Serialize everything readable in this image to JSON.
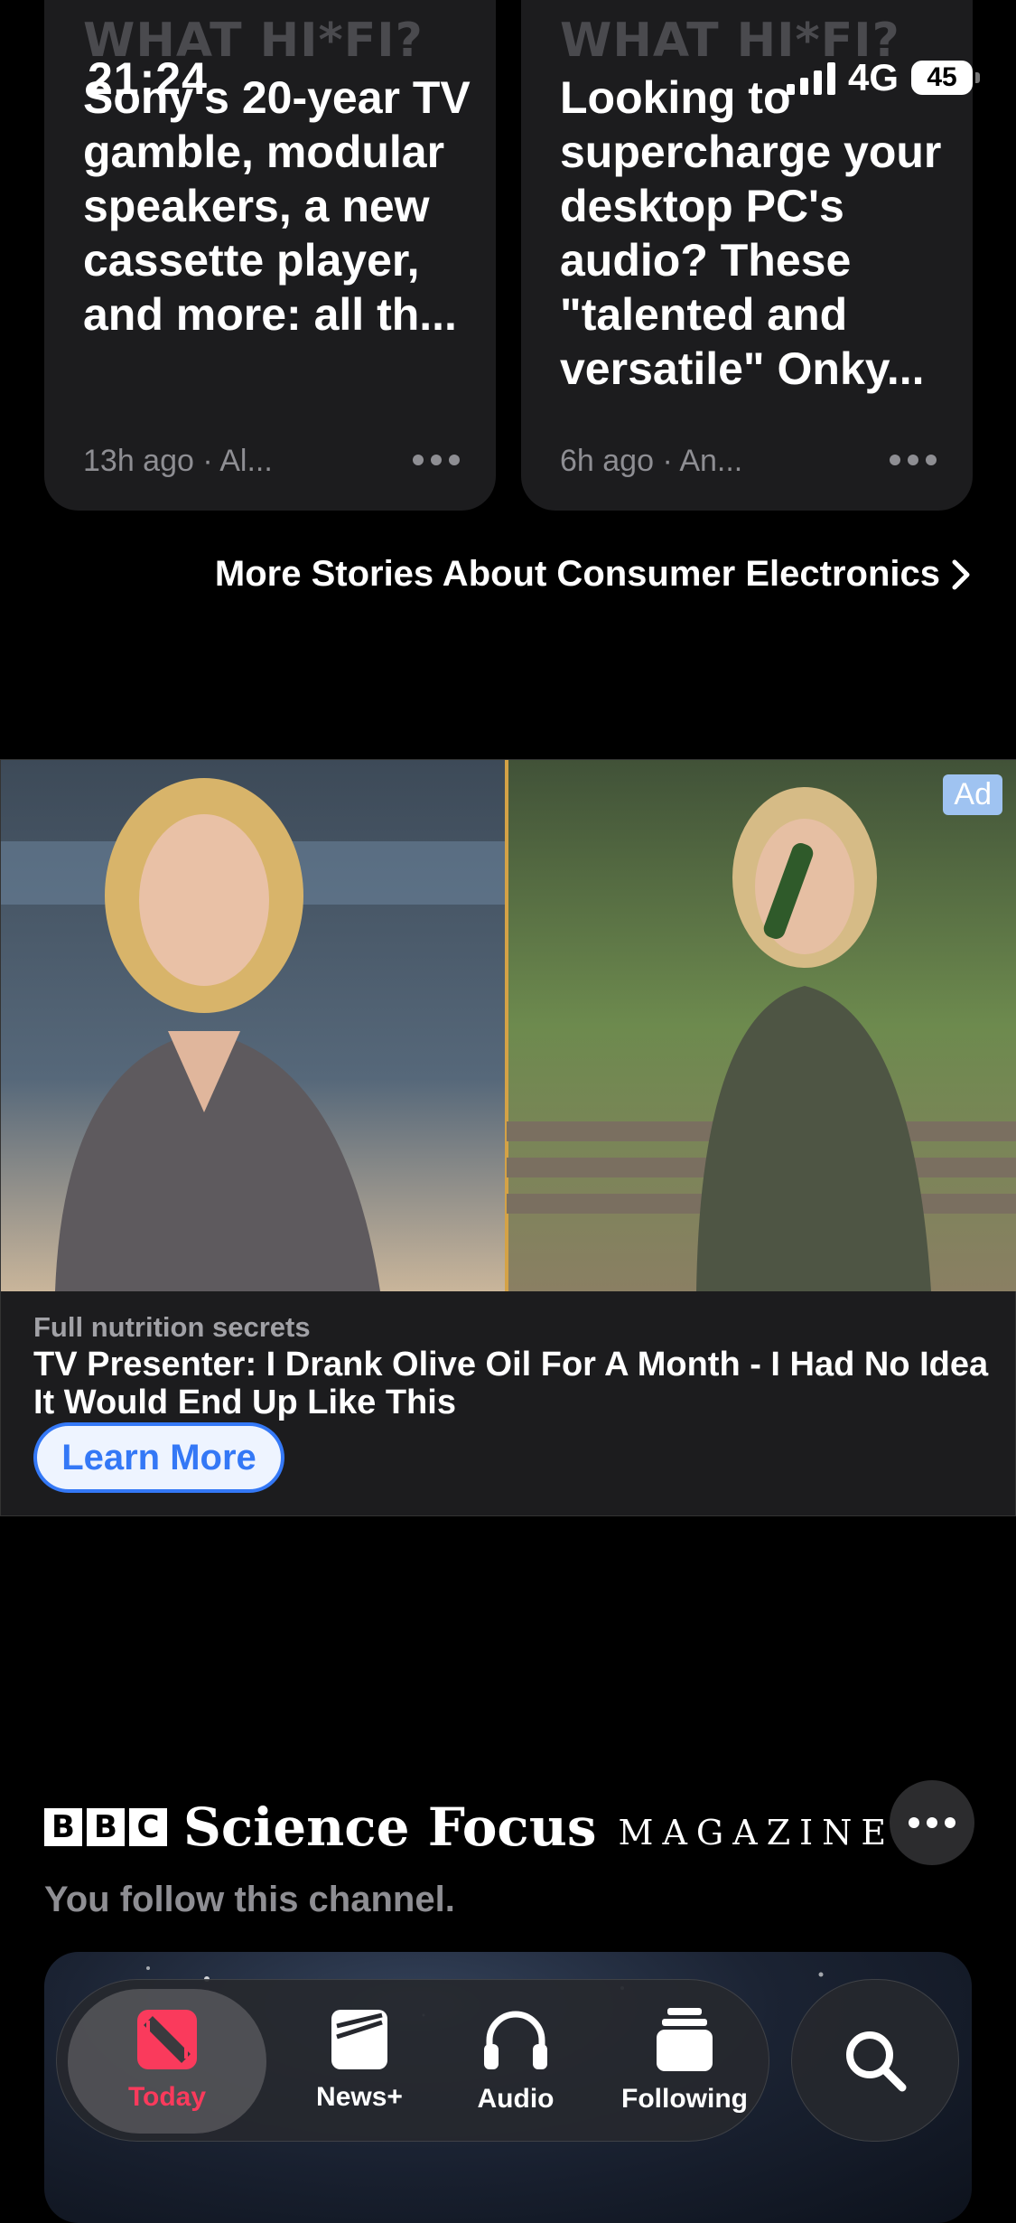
{
  "status_bar": {
    "time": "21:24",
    "network": "4G",
    "battery": "45"
  },
  "stories": [
    {
      "source": "WHAT HI*FI?",
      "title": "Sony's 20-year TV gamble, modular speakers, a new cassette player, and more: all th...",
      "meta": "13h ago · Al..."
    },
    {
      "source": "WHAT HI*FI?",
      "title": "Looking to supercharge your desktop PC's audio? These \"talented and versatile\" Onky...",
      "meta": "6h ago · An..."
    }
  ],
  "more_stories": "More Stories About Consumer Electronics",
  "ad": {
    "badge": "Ad",
    "sponsor": "Full nutrition secrets",
    "title": "TV Presenter: I Drank Olive Oil For A Month - I Had No Idea It Would End Up Like This",
    "cta": "Learn More"
  },
  "channel": {
    "bbc": [
      "B",
      "B",
      "C"
    ],
    "brand": "Science Focus",
    "brand_sub": "MAGAZINE",
    "follow_note": "You follow this channel."
  },
  "tabs": [
    {
      "label": "Today",
      "icon": "news-icon",
      "active": true
    },
    {
      "label": "News+",
      "icon": "news-plus-icon",
      "active": false
    },
    {
      "label": "Audio",
      "icon": "headphones-icon",
      "active": false
    },
    {
      "label": "Following",
      "icon": "following-icon",
      "active": false
    }
  ],
  "colors": {
    "accent": "#fa3a5c",
    "link": "#3478f6",
    "background": "#000000",
    "card": "#1c1c1e"
  }
}
